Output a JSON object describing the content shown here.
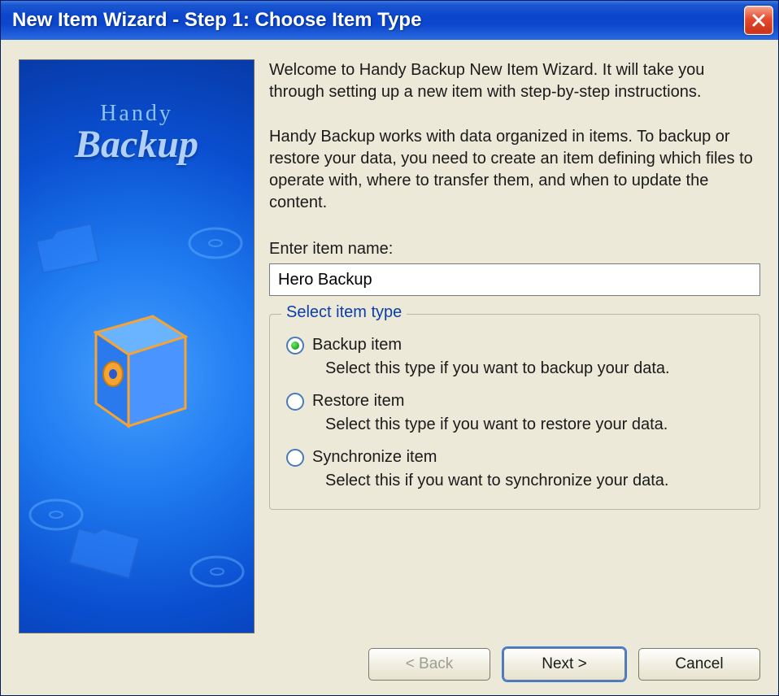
{
  "window": {
    "title": "New Item Wizard - Step 1: Choose Item Type"
  },
  "sidebar": {
    "logo_top": "Handy",
    "logo_bottom": "Backup"
  },
  "content": {
    "intro": "Welcome to Handy Backup New Item Wizard. It will take you through setting up a new item with step-by-step instructions.",
    "description": "Handy Backup works with data organized in items. To backup or restore your data, you need to create an item defining which files to operate with, where to transfer them, and when to update the content.",
    "name_label": "Enter item name:",
    "name_value": "Hero Backup",
    "group_legend": "Select item type",
    "options": [
      {
        "label": "Backup item",
        "desc": "Select this type if you want to backup your data.",
        "checked": true
      },
      {
        "label": "Restore item",
        "desc": "Select this type if you want to restore your data.",
        "checked": false
      },
      {
        "label": "Synchronize item",
        "desc": "Select this if you want to synchronize your data.",
        "checked": false
      }
    ]
  },
  "buttons": {
    "back": "< Back",
    "next": "Next >",
    "cancel": "Cancel"
  }
}
